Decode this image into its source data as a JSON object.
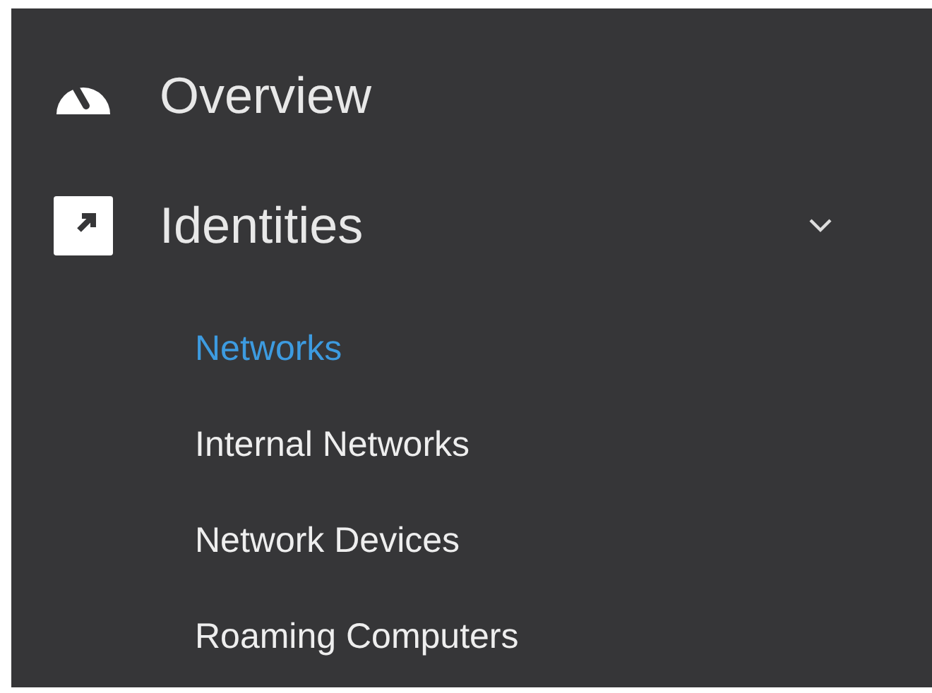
{
  "nav": [
    {
      "label": "Overview",
      "kind": "gauge"
    },
    {
      "label": "Identities",
      "kind": "arrow",
      "expanded": true,
      "children": [
        {
          "label": "Networks",
          "selected": true
        },
        {
          "label": "Internal Networks",
          "selected": false
        },
        {
          "label": "Network Devices",
          "selected": false
        },
        {
          "label": "Roaming Computers",
          "selected": false
        }
      ]
    }
  ]
}
